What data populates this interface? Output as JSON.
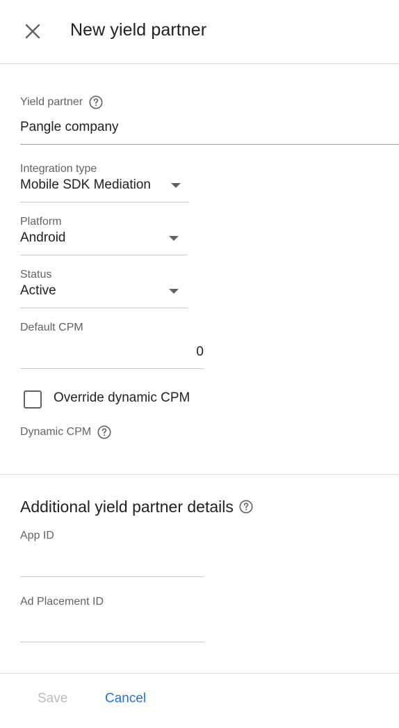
{
  "header": {
    "title": "New yield partner"
  },
  "form": {
    "yield_partner": {
      "label": "Yield partner",
      "value": "Pangle company"
    },
    "integration_type": {
      "label": "Integration type",
      "value": "Mobile SDK Mediation"
    },
    "platform": {
      "label": "Platform",
      "value": "Android"
    },
    "status": {
      "label": "Status",
      "value": "Active"
    },
    "default_cpm": {
      "label": "Default CPM",
      "value": "0"
    },
    "override_dynamic_cpm": {
      "label": "Override dynamic CPM",
      "checked": false
    },
    "dynamic_cpm": {
      "label": "Dynamic CPM"
    }
  },
  "additional": {
    "title": "Additional yield partner details",
    "app_id": {
      "label": "App ID",
      "value": ""
    },
    "ad_placement_id": {
      "label": "Ad Placement ID",
      "value": ""
    }
  },
  "footer": {
    "save_label": "Save",
    "cancel_label": "Cancel"
  },
  "colors": {
    "accent": "#1a73e8",
    "text_primary": "#202124",
    "text_secondary": "#5f6368",
    "disabled": "#b8bbbf",
    "divider": "#dadce0"
  }
}
